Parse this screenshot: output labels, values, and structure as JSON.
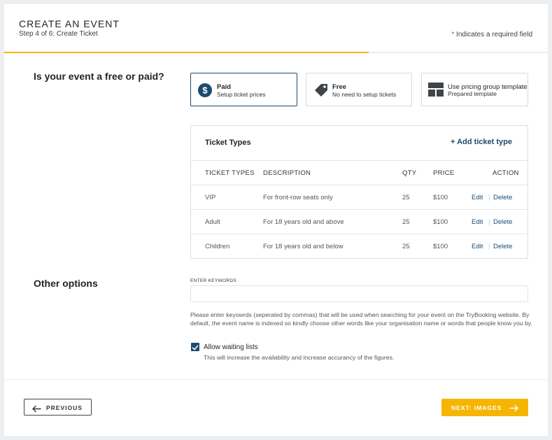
{
  "header": {
    "title": "CREATE AN EVENT",
    "step": "Step 4 of 6: Create Ticket",
    "required_star": "*",
    "required_text": " Indicates a required field",
    "progress": 0.67
  },
  "pricing": {
    "question": "Is your event a free or paid?",
    "options": [
      {
        "title": "Paid",
        "subtitle": "Setup ticket prices",
        "icon": "dollar-circle-icon",
        "selected": true
      },
      {
        "title": "Free",
        "subtitle": "No need to setup tickets",
        "icon": "tag-icon",
        "selected": false
      },
      {
        "title": "Use pricing group template",
        "subtitle": "Prepared template",
        "icon": "template-grid-icon",
        "selected": false
      }
    ]
  },
  "tickets": {
    "title": "Ticket Types",
    "add_label": "+ Add ticket type",
    "columns": [
      "TICKET TYPES",
      "DESCRIPTION",
      "QTY",
      "PRICE",
      "ACTION"
    ],
    "rows": [
      {
        "type": "VIP",
        "description": "For front-row seats only",
        "qty": "25",
        "price": "$100"
      },
      {
        "type": "Adult",
        "description": "For 18 years old and above",
        "qty": "25",
        "price": "$100"
      },
      {
        "type": "Children",
        "description": "For 18 years old and below",
        "qty": "25",
        "price": "$100"
      }
    ],
    "edit_label": "Edit",
    "separator": "|",
    "delete_label": "Delete"
  },
  "other": {
    "title": "Other options",
    "keywords_label": "ENTER KEYWORDS",
    "keywords_value": "",
    "help_text": "Please enter keyowrds (seperated by commas) that will be used when searching for your event on the TryBooking website. By default, the event name is indexed so kindly choose other words like your organisation name or words that people know you by.",
    "waiting_list_label": "Allow waiting lists",
    "waiting_list_checked": true,
    "waiting_list_help": "This will increase the availability and increase accurancy of the figures."
  },
  "footer": {
    "previous_label": "PREVIOUS",
    "next_label": "NEXT: IMAGES"
  },
  "colors": {
    "accent": "#f5b500",
    "primary": "#1d4b6e",
    "required": "#e0463b"
  }
}
